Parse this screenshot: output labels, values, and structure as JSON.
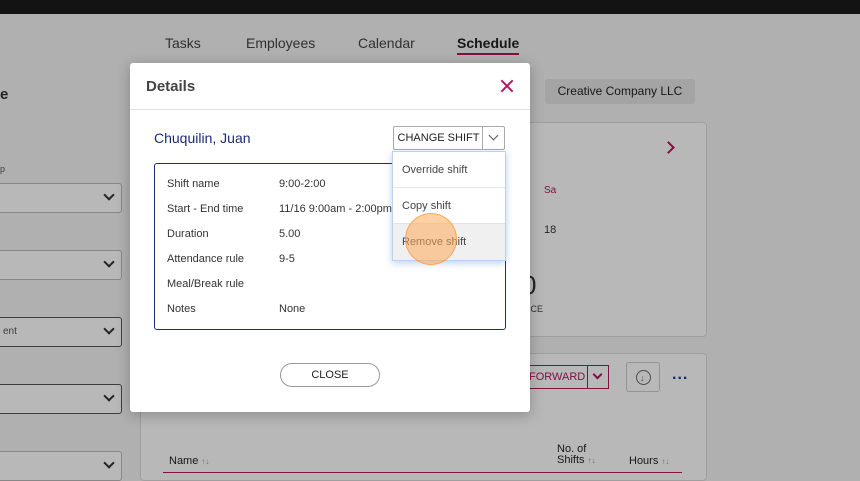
{
  "nav": {
    "tabs": [
      {
        "label": "Tasks"
      },
      {
        "label": "Employees"
      },
      {
        "label": "Calendar"
      },
      {
        "label": "Schedule"
      }
    ]
  },
  "left_panel": {
    "title_fragment": "e",
    "label_fragment": "p",
    "select_fragment": "ent"
  },
  "company": "Creative Company LLC",
  "calendar": {
    "day_header": "Sa",
    "day_number": "18",
    "summary_value": "0",
    "summary_label": "ENCE"
  },
  "actions": {
    "forward_label": "FORWARD",
    "more_label": "..."
  },
  "table": {
    "columns": [
      {
        "label": "Name",
        "sort": "↑↓"
      },
      {
        "label": "No. of",
        "label2": "Shifts",
        "sort": "↑↓"
      },
      {
        "label": "Hours",
        "sort": "↑↓"
      }
    ]
  },
  "modal": {
    "title": "Details",
    "employee_name": "Chuquilin, Juan",
    "change_shift_label": "CHANGE SHIFT",
    "details": [
      {
        "label": "Shift name",
        "value": "9:00-2:00"
      },
      {
        "label": "Start - End time",
        "value": "11/16 9:00am - 2:00pm"
      },
      {
        "label": "Duration",
        "value": "5.00"
      },
      {
        "label": "Attendance rule",
        "value": "9-5"
      },
      {
        "label": "Meal/Break rule",
        "value": ""
      },
      {
        "label": "Notes",
        "value": "None"
      }
    ],
    "close_label": "CLOSE"
  },
  "dropdown": {
    "items": [
      {
        "label": "Override shift"
      },
      {
        "label": "Copy shift"
      },
      {
        "label": "Remove shift"
      }
    ]
  },
  "colors": {
    "accent": "#b5175e",
    "name_blue": "#1a2b7a"
  }
}
